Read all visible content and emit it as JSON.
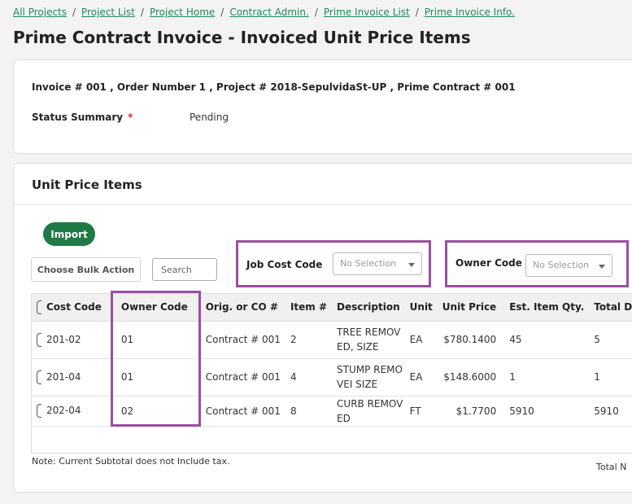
{
  "breadcrumb": [
    "All Projects",
    "Project List",
    "Project Home",
    "Contract Admin.",
    "Prime Invoice List",
    "Prime Invoice Info."
  ],
  "page_title": "Prime Contract Invoice - Invoiced Unit Price Items",
  "summary": {
    "line": "Invoice # 001 , Order Number 1 , Project # 2018-SepulvidaSt-UP , Prime Contract # 001",
    "status_label": "Status Summary",
    "required_mark": "*",
    "status_value": "Pending"
  },
  "unit_price": {
    "title": "Unit Price Items",
    "import_label": "Import",
    "bulk_action_label": "Choose Bulk Action",
    "search_placeholder": "Search",
    "filters": {
      "job_cost_code": {
        "label": "Job Cost Code",
        "value": "No Selection"
      },
      "owner_code": {
        "label": "Owner Code",
        "value": "No Selection"
      }
    },
    "columns": [
      "Cost Code",
      "Owner Code",
      "Orig. or CO #",
      "Item #",
      "Description",
      "Unit",
      "Unit Price",
      "Est. Item Qty.",
      "Total Daily Lo"
    ],
    "rows": [
      {
        "cost_code": "201-02",
        "owner_code": "01",
        "orig": "Contract # 001",
        "item": "2",
        "description": "TREE REMOVED, SIZE",
        "unit": "EA",
        "unit_price": "$780.1400",
        "est_qty": "45",
        "total_daily": "5"
      },
      {
        "cost_code": "201-04",
        "owner_code": "01",
        "orig": "Contract # 001",
        "item": "4",
        "description": "STUMP REMOVEI SIZE",
        "unit": "EA",
        "unit_price": "$148.6000",
        "est_qty": "1",
        "total_daily": "1"
      },
      {
        "cost_code": "202-04",
        "owner_code": "02",
        "orig": "Contract # 001",
        "item": "8",
        "description": "CURB REMOVED",
        "unit": "FT",
        "unit_price": "$1.7700",
        "est_qty": "5910",
        "total_daily": "5910"
      }
    ],
    "note": "Note: Current Subtotal does not Include tax.",
    "total_label": "Total N"
  }
}
